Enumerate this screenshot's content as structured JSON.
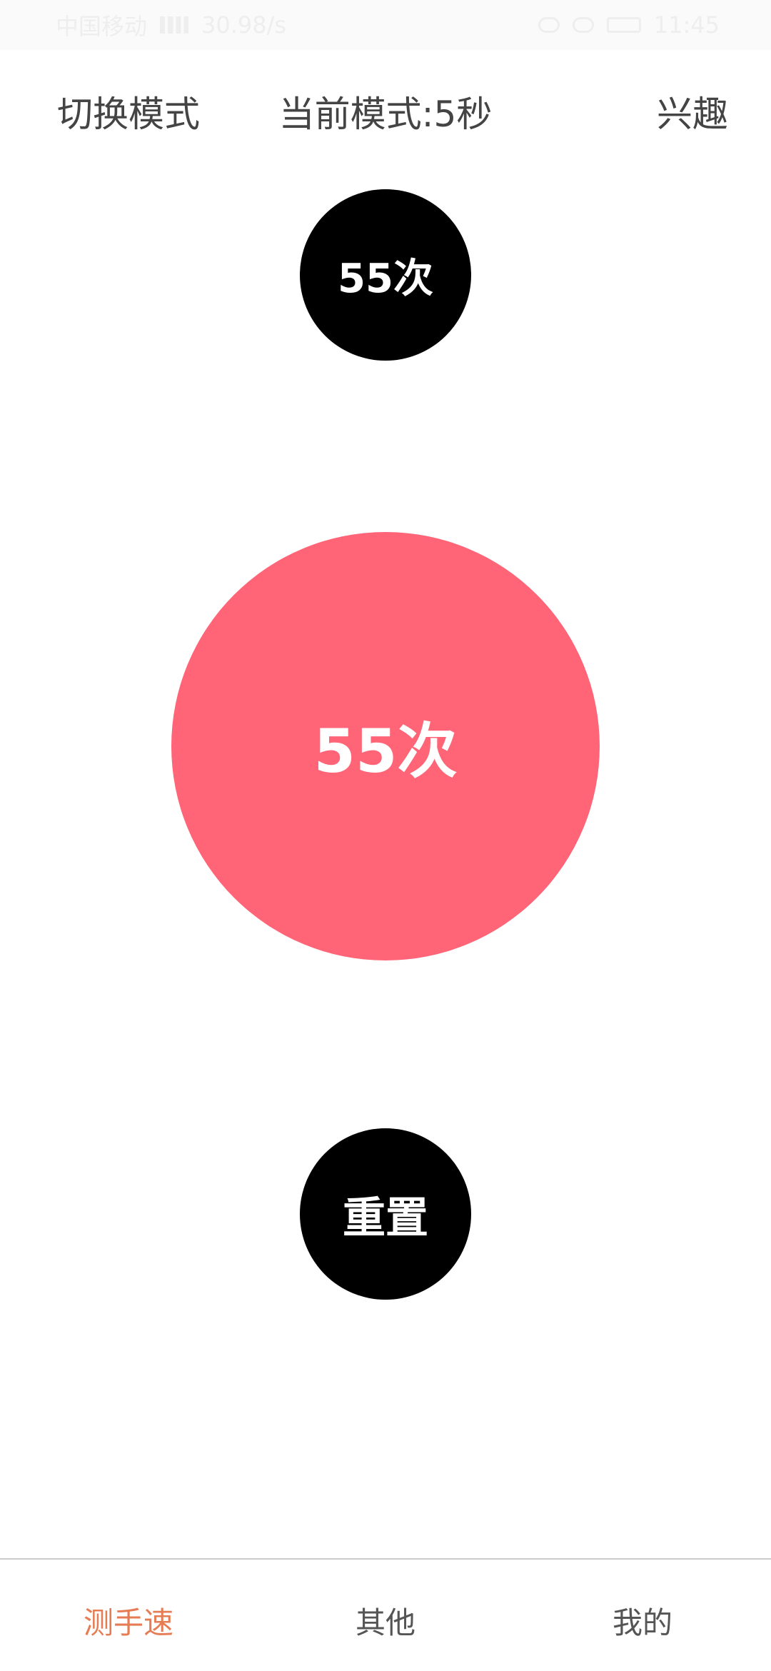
{
  "status_bar": {
    "carrier": "中国移动",
    "network_speed": "30.98/s",
    "time": "11:45"
  },
  "header": {
    "switch_mode_label": "切换模式",
    "current_mode_label": "当前模式:5秒",
    "interest_label": "兴趣"
  },
  "top_count": "55次",
  "tap_area": {
    "count": "55次",
    "color": "#ff6477"
  },
  "reset_button": {
    "label": "重置"
  },
  "bottom_nav": {
    "items": [
      {
        "label": "测手速",
        "active": true
      },
      {
        "label": "其他",
        "active": false
      },
      {
        "label": "我的",
        "active": false
      }
    ],
    "active_color": "#e67c54"
  },
  "icons": [
    "signal-icon",
    "eye-icon",
    "alarm-icon",
    "battery-icon"
  ]
}
